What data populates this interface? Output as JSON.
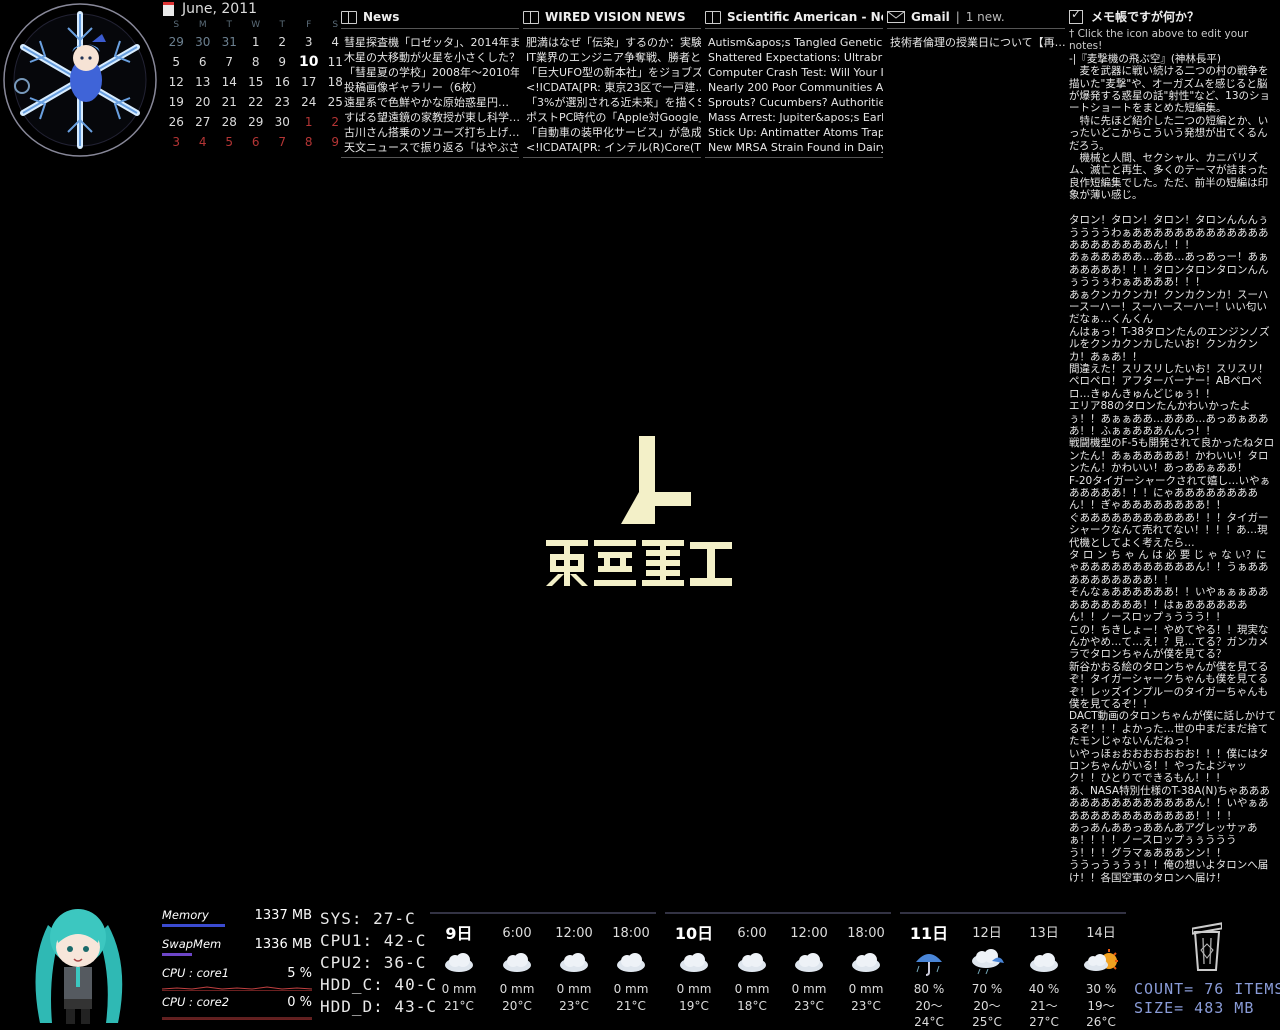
{
  "calendar": {
    "title": "June, 2011",
    "days_of_week": [
      "S",
      "M",
      "T",
      "W",
      "T",
      "F",
      "S"
    ],
    "weeks": [
      [
        "29",
        "30",
        "31",
        "1",
        "2",
        "3",
        "4"
      ],
      [
        "5",
        "6",
        "7",
        "8",
        "9",
        "10",
        "11"
      ],
      [
        "12",
        "13",
        "14",
        "15",
        "16",
        "17",
        "18"
      ],
      [
        "19",
        "20",
        "21",
        "22",
        "23",
        "24",
        "25"
      ],
      [
        "26",
        "27",
        "28",
        "29",
        "30",
        "1",
        "2"
      ],
      [
        "3",
        "4",
        "5",
        "6",
        "7",
        "8",
        "9"
      ]
    ],
    "today": "10"
  },
  "feeds": [
    {
      "title": "News",
      "items": [
        "彗星探査機「ロゼッタ」、2014年まで…",
        "木星の大移動が火星を小さくした？",
        "「彗星夏の学校」2008年〜2010年…",
        "投稿画像ギャラリー（6枚）",
        "遠星系で色鮮やかな原始惑星円…",
        "すばる望遠鏡の家教授が東し科学…",
        "古川さん搭乗のソユーズ打ち上げ…",
        "天文ニュースで振り返る「はやぶさ」…"
      ]
    },
    {
      "title": "WIRED VISION NEWS",
      "items": [
        "肥満はなぜ「伝染」するのか：実験…",
        "IT業界のエンジニア争奪戦、勝者と…",
        "「巨大UFO型の新本社」をジョブズ…",
        "<!ICDATA[PR: 東京23区で一戸建…",
        "「3%が選別される近未来」を描くSF…",
        "ポストPC時代の「Apple対Google」",
        "「自動車の装甲化サービス」が急成…",
        "<!ICDATA[PR: インテル(R)Core(TM)…"
      ]
    },
    {
      "title": "Scientific American - News",
      "items": [
        "Autism&apos;s Tangled Genetics…",
        "Shattered Expectations: Ultrabrig…",
        "Computer Crash Test: Will Your In…",
        "Nearly 200 Poor Communities Aw…",
        "Sprouts? Cucumbers? Authorities S…",
        "Mass Arrest: Jupiter&apos;s Early…",
        "Stick Up: Antimatter Atoms Trapp…",
        "New MRSA Strain Found in Dairy C…"
      ]
    },
    {
      "title": "Gmail",
      "count": "1 new.",
      "items": [
        "技術者倫理の授業日について【再…"
      ]
    }
  ],
  "memo": {
    "title": "メモ帳ですが何か？",
    "hint": "Click the icon above to edit your notes!",
    "body": "-|『麦撃機の飛ぶ空』(神林長平)\n　麦を武器に戦い続ける二つの村の戦争を描いた\"麦撃\"や、オーガズムを感じると脳が爆発する惑星の話\"射性\"など、13のショートショートをまとめた短編集。\n　特に先ほど紹介した二つの短編とか、いったいどこからこういう発想が出てくるんだろう。\n　機械と人間、セクシャル、カニバリズム、滅亡と再生、多くのテーマが詰まった良作短編集でした。ただ、前半の短編は印象が薄い感じ。\n\nタロン！タロン！タロン！タロンんんんぅううううわぁあああああああああああああああああああああん！！！\nあぁあああああ…ああ…あっあっー！あぁあああああ！！！タロンタロンタロンんんぅううぅわぁああああ！！！\nあぁクンカクンカ！クンカクンカ！スーハースーハー！スーハースーハー！いい匂いだなぁ…くんくん\nんはぁっ！T-38タロンたんのエンジンノズルをクンカクンカしたいお！クンカクンカ！あぁあ！！\n間違えた！スリスリしたいお！スリスリ！ペロペロ！アフターバーナー！ABペロペロ…きゅんきゅんどじゅぅ！！\nエリア88のタロンたんかわいかったよぅ！！あぁぁああ…あああ…あっあぁあああ！！ふぁぁあああんんっ！！\n戦闘機型のF-5も開発されて良かったねタロンたん！あぁあああああ！かわいい！タロンたん！かわいい！あっああぁああ！\nF-20タイガーシャークされて嬉し…いやぁあああああ！！！にゃああああああああん！！ぎゃああああああああ！！\nぐあああああああああああ！！！タイガーシャークなんて売れてない！！！！あ…現代機としてよく考えたら…\nタ ロ ン ち ゃ ん は 必 要 じ ゃ な い？にゃあああああああああああん！！うぁああああああああああ！！\nそんなぁああああああ！！いやぁぁぁあああああああああ！！はぁああああああん！！ノースロップぅううう！！\nこの！ちきしょー！やめてやる！！現実なんかやめ…て…え！？見…てる？ガンカメラでタロンちゃんが僕を見てる？\n新谷かおる絵のタロンちゃんが僕を見てるぞ！タイガーシャークちゃんも僕を見てるぞ！レッズインプルーのタイガーちゃんも僕を見てるぞ！！\nDACT動画のタロンちゃんが僕に話しかけてるぞ！！！よかった…世の中まだまだ捨てたモンじゃないんだねっ！\nいやっほぉおおおおおおお！！！僕にはタロンちゃんがいる！！やったよジャック！！ひとりでできるもん！！！\nあ、NASA特別仕様のT-38A(N)ちゃあああああああああああああああん！！いやぁあああああああああああああ！！！！\nあっあんああっああんあアグレッサァあぁ！！！！ノースロップぅぅうううう！！！グラマぁあああンン！！\nううっうぅうぅ！！俺の想いよタロンへ届け！！各国空軍のタロンへ届け！"
  },
  "system": {
    "memory_label": "Memory",
    "memory_value": "1337 MB",
    "memory_fraction": 0.42,
    "swap_label": "SwapMem",
    "swap_value": "1336 MB",
    "swap_fraction": 0.2,
    "cpu1_label": "CPU : core1",
    "cpu1_value": "5 %",
    "cpu2_label": "CPU : core2",
    "cpu2_value": "0 %"
  },
  "temps": [
    "SYS: 27-C",
    "CPU1: 42-C",
    "CPU2: 36-C",
    "HDD_C: 40-C",
    "HDD_D: 43-C"
  ],
  "weather": {
    "day9": {
      "label": "9日",
      "slots": [
        {
          "time": "9日",
          "precip": "0 mm",
          "temp": "21°C",
          "icon": "cloud-icon"
        },
        {
          "time": "6:00",
          "precip": "0 mm",
          "temp": "20°C",
          "icon": "cloud-icon"
        },
        {
          "time": "12:00",
          "precip": "0 mm",
          "temp": "23°C",
          "icon": "cloud-icon"
        },
        {
          "time": "18:00",
          "precip": "0 mm",
          "temp": "21°C",
          "icon": "cloud-icon"
        }
      ]
    },
    "day10": {
      "label": "10日",
      "slots": [
        {
          "time": "10日",
          "precip": "0 mm",
          "temp": "19°C",
          "icon": "cloud-icon"
        },
        {
          "time": "6:00",
          "precip": "0 mm",
          "temp": "18°C",
          "icon": "cloud-icon"
        },
        {
          "time": "12:00",
          "precip": "0 mm",
          "temp": "23°C",
          "icon": "cloud-icon"
        },
        {
          "time": "18:00",
          "precip": "0 mm",
          "temp": "23°C",
          "icon": "cloud-icon"
        }
      ]
    },
    "week": [
      {
        "day": "11日",
        "pop": "80 %",
        "range": "20～24°C",
        "icon": "umbrella-rain-icon"
      },
      {
        "day": "12日",
        "pop": "70 %",
        "range": "20～25°C",
        "icon": "cloud-rain-icon"
      },
      {
        "day": "13日",
        "pop": "40 %",
        "range": "21～27°C",
        "icon": "cloud-icon"
      },
      {
        "day": "14日",
        "pop": "30 %",
        "range": "19～26°C",
        "icon": "sun-cloud-icon"
      }
    ]
  },
  "trash": {
    "count": "COUNT= 76 ITEMS",
    "size": "SIZE= 483 MB"
  },
  "colors": {
    "accent": "#3b4bd0",
    "weekend_red": "#b43535",
    "logo": "#f3f0c8",
    "trash_text": "#8a9cd8"
  }
}
